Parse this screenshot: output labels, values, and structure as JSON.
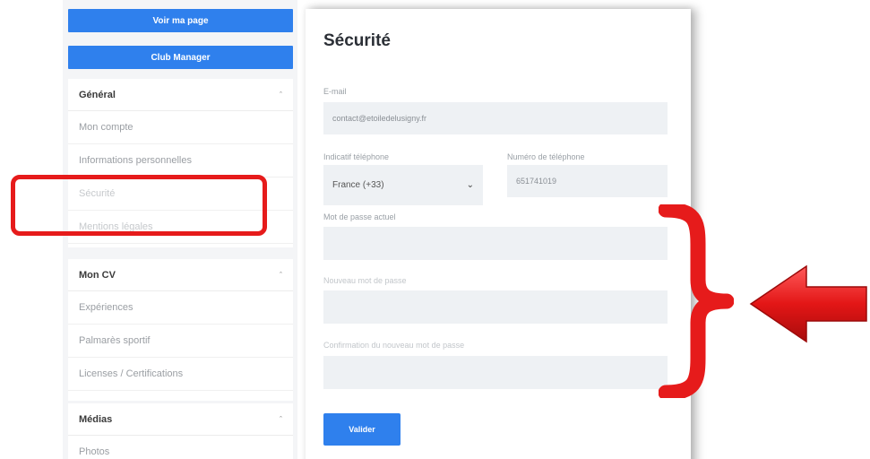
{
  "sidebar": {
    "view_page_label": "Voir ma page",
    "club_manager_label": "Club Manager",
    "general": {
      "title": "Général",
      "items": [
        "Mon compte",
        "Informations personnelles",
        "Sécurité",
        "Mentions légales"
      ]
    },
    "cv": {
      "title": "Mon CV",
      "items": [
        "Expériences",
        "Palmarès sportif",
        "Licenses / Certifications"
      ]
    },
    "medias": {
      "title": "Médias",
      "items": [
        "Photos"
      ]
    }
  },
  "main": {
    "title": "Sécurité",
    "email_label": "E-mail",
    "email_value": "contact@etoiledelusigny.fr",
    "phone_code_label": "Indicatif téléphone",
    "phone_code_value": "France (+33)",
    "phone_number_label": "Numéro de téléphone",
    "phone_number_value": "651741019",
    "current_password_label": "Mot de passe actuel",
    "new_password_label": "Nouveau mot de passe",
    "confirm_password_label": "Confirmation du nouveau mot de passe",
    "submit_label": "Valider"
  },
  "icons": {
    "section_chevron": "chevron-up-icon",
    "select_caret": "chevron-down-icon"
  },
  "colors": {
    "primary": "#2f80ed",
    "annotation_red": "#e61b1b",
    "field_bg": "#eef1f4"
  }
}
